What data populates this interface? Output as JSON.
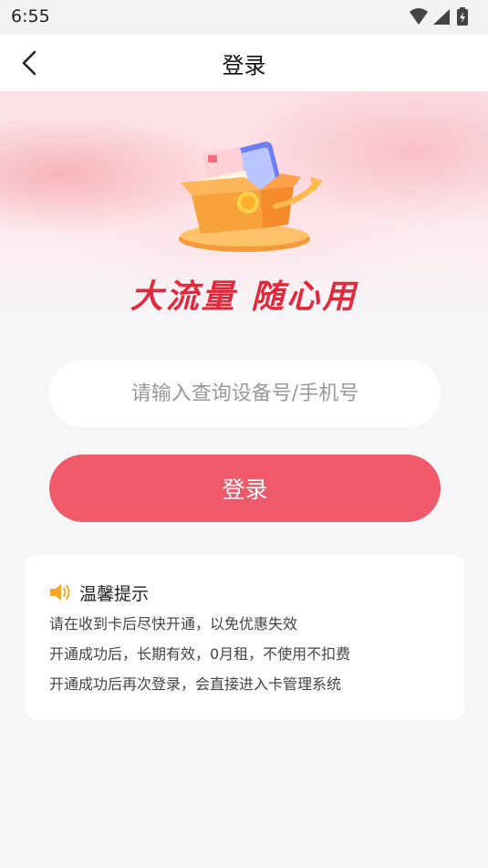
{
  "status_bar": {
    "time": "6:55",
    "icons": [
      "wifi-icon",
      "signal-icon",
      "battery-charging-icon"
    ]
  },
  "nav": {
    "title": "登录",
    "back_icon": "chevron-left-icon"
  },
  "hero": {
    "slogan": "大流量 随心用",
    "illustration": "gift-box-phone-illustration",
    "colors": {
      "slogan": "#e2283a",
      "box": "#f7a23a"
    }
  },
  "form": {
    "input_placeholder": "请输入查询设备号/手机号",
    "input_value": "",
    "login_button_label": "登录",
    "button_color": "#ef5a6b"
  },
  "tips": {
    "icon": "speaker-icon",
    "title": "温馨提示",
    "lines": [
      "请在收到卡后尽快开通，以免优惠失效",
      "开通成功后，长期有效，0月租，不使用不扣费",
      "开通成功后再次登录，会直接进入卡管理系统"
    ]
  }
}
